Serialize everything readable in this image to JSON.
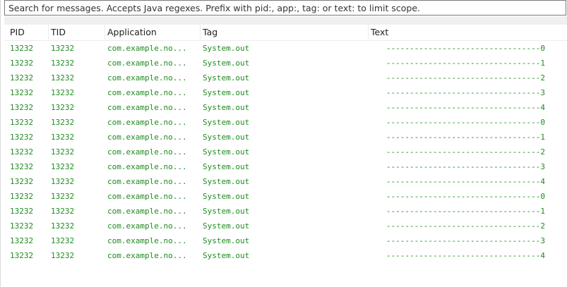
{
  "search": {
    "placeholder": "Search for messages. Accepts Java regexes. Prefix with pid:, app:, tag: or text: to limit scope."
  },
  "columns": {
    "pid": "PID",
    "tid": "TID",
    "application": "Application",
    "tag": "Tag",
    "text": "Text"
  },
  "rows": [
    {
      "pid": "13232",
      "tid": "13232",
      "application": "com.example.no...",
      "tag": "System.out",
      "text": "---------------------------------0"
    },
    {
      "pid": "13232",
      "tid": "13232",
      "application": "com.example.no...",
      "tag": "System.out",
      "text": "---------------------------------1"
    },
    {
      "pid": "13232",
      "tid": "13232",
      "application": "com.example.no...",
      "tag": "System.out",
      "text": "---------------------------------2"
    },
    {
      "pid": "13232",
      "tid": "13232",
      "application": "com.example.no...",
      "tag": "System.out",
      "text": "---------------------------------3"
    },
    {
      "pid": "13232",
      "tid": "13232",
      "application": "com.example.no...",
      "tag": "System.out",
      "text": "---------------------------------4"
    },
    {
      "pid": "13232",
      "tid": "13232",
      "application": "com.example.no...",
      "tag": "System.out",
      "text": "---------------------------------0"
    },
    {
      "pid": "13232",
      "tid": "13232",
      "application": "com.example.no...",
      "tag": "System.out",
      "text": "---------------------------------1"
    },
    {
      "pid": "13232",
      "tid": "13232",
      "application": "com.example.no...",
      "tag": "System.out",
      "text": "---------------------------------2"
    },
    {
      "pid": "13232",
      "tid": "13232",
      "application": "com.example.no...",
      "tag": "System.out",
      "text": "---------------------------------3"
    },
    {
      "pid": "13232",
      "tid": "13232",
      "application": "com.example.no...",
      "tag": "System.out",
      "text": "---------------------------------4"
    },
    {
      "pid": "13232",
      "tid": "13232",
      "application": "com.example.no...",
      "tag": "System.out",
      "text": "---------------------------------0"
    },
    {
      "pid": "13232",
      "tid": "13232",
      "application": "com.example.no...",
      "tag": "System.out",
      "text": "---------------------------------1"
    },
    {
      "pid": "13232",
      "tid": "13232",
      "application": "com.example.no...",
      "tag": "System.out",
      "text": "---------------------------------2"
    },
    {
      "pid": "13232",
      "tid": "13232",
      "application": "com.example.no...",
      "tag": "System.out",
      "text": "---------------------------------3"
    },
    {
      "pid": "13232",
      "tid": "13232",
      "application": "com.example.no...",
      "tag": "System.out",
      "text": "---------------------------------4"
    }
  ],
  "colors": {
    "log_text": "#1e8c1e",
    "header_text": "#222222",
    "search_border": "#7a7a7a"
  }
}
